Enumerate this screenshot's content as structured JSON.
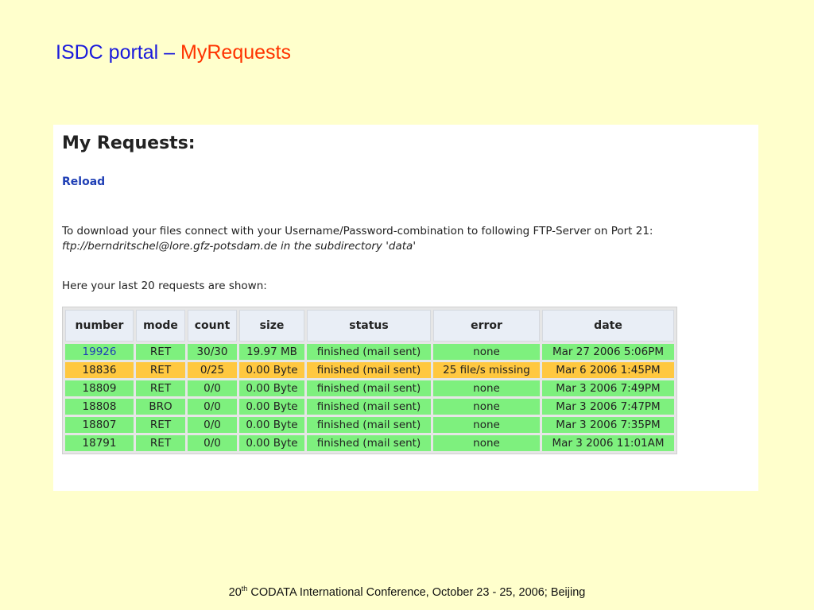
{
  "slide": {
    "title_main": "ISDC portal",
    "title_dash": "–",
    "title_accent": "MyRequests"
  },
  "screen": {
    "heading": "My Requests:",
    "reload_label": "Reload",
    "info_line1": "To download your files connect with your Username/Password-combination to following FTP-Server on Port 21:",
    "info_line2": "ftp://berndritschel@lore.gfz-potsdam.de in the subdirectory 'data'",
    "requests_note": "Here your last 20 requests are shown:",
    "columns": [
      "number",
      "mode",
      "count",
      "size",
      "status",
      "error",
      "date"
    ],
    "rows": [
      {
        "number": "19926",
        "mode": "RET",
        "count": "30/30",
        "size": "19.97 MB",
        "status": "finished (mail sent)",
        "error": "none",
        "date": "Mar 27 2006 5:06PM",
        "state": "ok"
      },
      {
        "number": "18836",
        "mode": "RET",
        "count": "0/25",
        "size": "0.00 Byte",
        "status": "finished (mail sent)",
        "error": "25 file/s missing",
        "date": "Mar 6 2006 1:45PM",
        "state": "warn"
      },
      {
        "number": "18809",
        "mode": "RET",
        "count": "0/0",
        "size": "0.00 Byte",
        "status": "finished (mail sent)",
        "error": "none",
        "date": "Mar 3 2006 7:49PM",
        "state": "ok"
      },
      {
        "number": "18808",
        "mode": "BRO",
        "count": "0/0",
        "size": "0.00 Byte",
        "status": "finished (mail sent)",
        "error": "none",
        "date": "Mar 3 2006 7:47PM",
        "state": "ok"
      },
      {
        "number": "18807",
        "mode": "RET",
        "count": "0/0",
        "size": "0.00 Byte",
        "status": "finished (mail sent)",
        "error": "none",
        "date": "Mar 3 2006 7:35PM",
        "state": "ok"
      },
      {
        "number": "18791",
        "mode": "RET",
        "count": "0/0",
        "size": "0.00 Byte",
        "status": "finished (mail sent)",
        "error": "none",
        "date": "Mar 3 2006 11:01AM",
        "state": "ok"
      }
    ]
  },
  "footer": {
    "ordinal_num": "20",
    "ordinal_suffix": "th",
    "text": " CODATA International Conference, October 23 - 25, 2006; Beijing"
  },
  "colors": {
    "background": "#ffffcc",
    "title_blue": "#1a1adc",
    "title_accent": "#ff3300",
    "row_ok": "#7ef07e",
    "row_warn": "#ffc840",
    "link": "#1f3fb5"
  }
}
